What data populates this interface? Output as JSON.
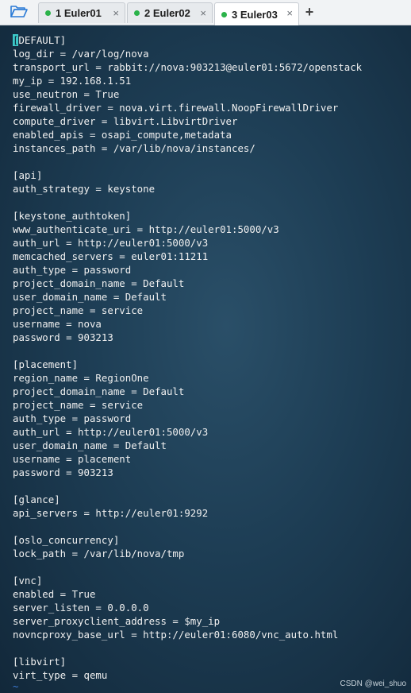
{
  "tabs": [
    {
      "label": "1 Euler01",
      "close": "×",
      "active": false
    },
    {
      "label": "2 Euler02",
      "close": "×",
      "active": false
    },
    {
      "label": "3 Euler03",
      "close": "×",
      "active": true
    }
  ],
  "add_tab_label": "+",
  "terminal": {
    "cursor_text": "[",
    "lines": [
      "DEFAULT]",
      "log_dir = /var/log/nova",
      "transport_url = rabbit://nova:903213@euler01:5672/openstack",
      "my_ip = 192.168.1.51",
      "use_neutron = True",
      "firewall_driver = nova.virt.firewall.NoopFirewallDriver",
      "compute_driver = libvirt.LibvirtDriver",
      "enabled_apis = osapi_compute,metadata",
      "instances_path = /var/lib/nova/instances/",
      "",
      "[api]",
      "auth_strategy = keystone",
      "",
      "[keystone_authtoken]",
      "www_authenticate_uri = http://euler01:5000/v3",
      "auth_url = http://euler01:5000/v3",
      "memcached_servers = euler01:11211",
      "auth_type = password",
      "project_domain_name = Default",
      "user_domain_name = Default",
      "project_name = service",
      "username = nova",
      "password = 903213",
      "",
      "[placement]",
      "region_name = RegionOne",
      "project_domain_name = Default",
      "project_name = service",
      "auth_type = password",
      "auth_url = http://euler01:5000/v3",
      "user_domain_name = Default",
      "username = placement",
      "password = 903213",
      "",
      "[glance]",
      "api_servers = http://euler01:9292",
      "",
      "[oslo_concurrency]",
      "lock_path = /var/lib/nova/tmp",
      "",
      "[vnc]",
      "enabled = True",
      "server_listen = 0.0.0.0",
      "server_proxyclient_address = $my_ip",
      "novncproxy_base_url = http://euler01:6080/vnc_auto.html",
      "",
      "[libvirt]",
      "virt_type = qemu"
    ],
    "tilde": "~"
  },
  "watermark": "CSDN @wei_shuo",
  "colors": {
    "terminal_bg": "#1d3d54",
    "text": "#f0f0f0",
    "cursor": "#3cc9c9",
    "active_dot": "#2bb34a",
    "tilde": "#3d7bd6"
  },
  "icons": {
    "open_folder": "folder-open-icon"
  }
}
